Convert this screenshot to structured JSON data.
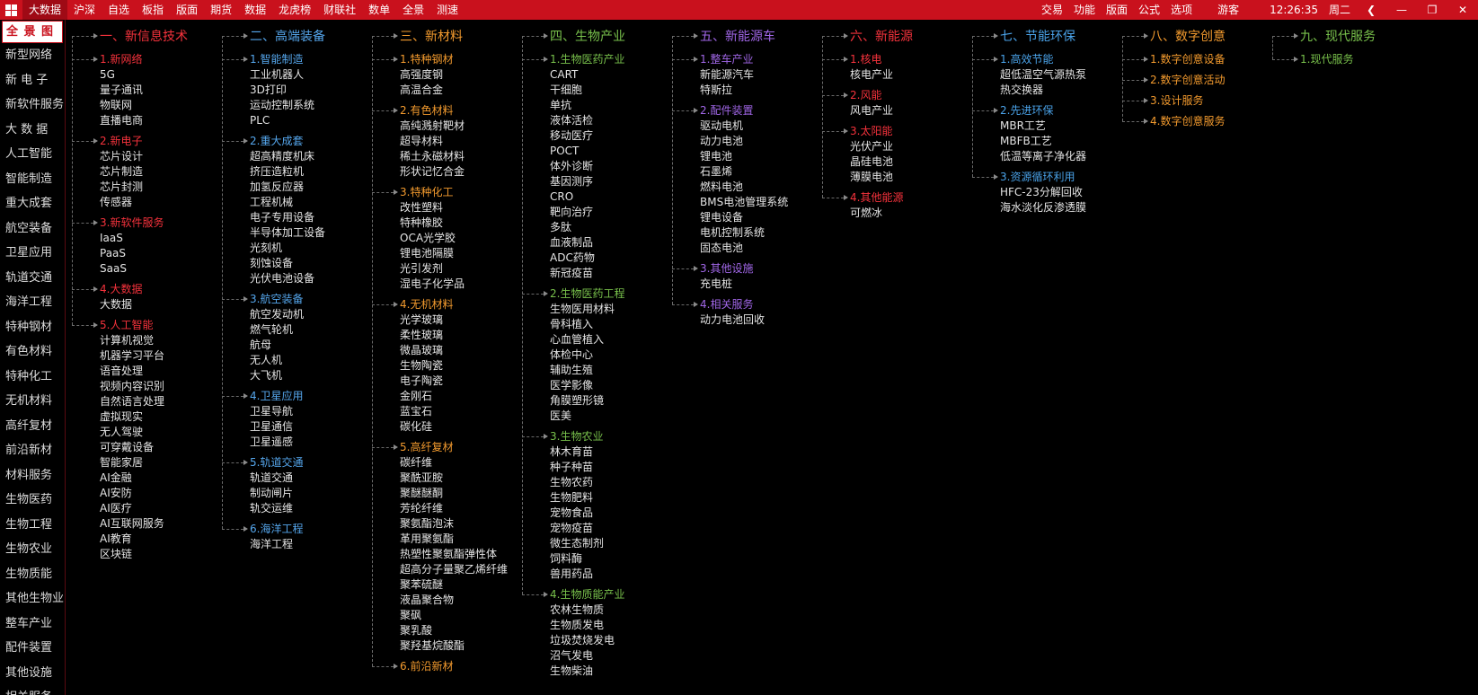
{
  "topbar": {
    "menu": [
      "大数据",
      "沪深",
      "自选",
      "板指",
      "版面",
      "期货",
      "数据",
      "龙虎榜",
      "财联社",
      "数单",
      "全景",
      "测速"
    ],
    "active_index": 0,
    "right": [
      "交易",
      "功能",
      "版面",
      "公式",
      "选项"
    ],
    "user": "游客",
    "time": "12:26:35",
    "weekday": "周二"
  },
  "sidebar": {
    "selected": "全 景 图",
    "items": [
      "新型网络",
      "新 电 子",
      "新软件服务",
      "大 数 据",
      "人工智能",
      "智能制造",
      "重大成套",
      "航空装备",
      "卫星应用",
      "轨道交通",
      "海洋工程",
      "特种钢材",
      "有色材料",
      "特种化工",
      "无机材料",
      "高纤复材",
      "前沿新材",
      "材料服务",
      "生物医药",
      "生物工程",
      "生物农业",
      "生物质能",
      "其他生物业",
      "整车产业",
      "配件装置",
      "其他设施",
      "相关服务"
    ]
  },
  "colors": {
    "red": "#f5323c",
    "blue": "#55a6ec",
    "orange": "#f29a2e",
    "green": "#78c04b",
    "purple": "#a066e6",
    "sky": "#4aa2e8"
  },
  "columns": [
    {
      "title": "一、新信息技术",
      "color": "red",
      "subs": [
        {
          "title": "1.新网络",
          "items": [
            "5G",
            "量子通讯",
            "物联网",
            "直播电商"
          ]
        },
        {
          "title": "2.新电子",
          "items": [
            "芯片设计",
            "芯片制造",
            "芯片封测",
            "传感器"
          ]
        },
        {
          "title": "3.新软件服务",
          "items": [
            "IaaS",
            "PaaS",
            "SaaS"
          ]
        },
        {
          "title": "4.大数据",
          "items": [
            "大数据"
          ]
        },
        {
          "title": "5.人工智能",
          "items": [
            "计算机视觉",
            "机器学习平台",
            "语音处理",
            "视频内容识别",
            "自然语言处理",
            "虚拟现实",
            "无人驾驶",
            "可穿戴设备",
            "智能家居",
            "AI金融",
            "AI安防",
            "AI医疗",
            "AI互联网服务",
            "AI教育",
            "区块链"
          ]
        }
      ]
    },
    {
      "title": "二、高端装备",
      "color": "blue",
      "subs": [
        {
          "title": "1.智能制造",
          "items": [
            "工业机器人",
            "3D打印",
            "运动控制系统",
            "PLC"
          ]
        },
        {
          "title": "2.重大成套",
          "items": [
            "超高精度机床",
            "挤压造粒机",
            "加氢反应器",
            "工程机械",
            "电子专用设备",
            "半导体加工设备",
            "光刻机",
            "刻蚀设备",
            "光伏电池设备"
          ]
        },
        {
          "title": "3.航空装备",
          "items": [
            "航空发动机",
            "燃气轮机",
            "航母",
            "无人机",
            "大飞机"
          ]
        },
        {
          "title": "4.卫星应用",
          "items": [
            "卫星导航",
            "卫星通信",
            "卫星遥感"
          ]
        },
        {
          "title": "5.轨道交通",
          "items": [
            "轨道交通",
            "制动闸片",
            "轨交运维"
          ]
        },
        {
          "title": "6.海洋工程",
          "items": [
            "海洋工程"
          ]
        }
      ]
    },
    {
      "title": "三、新材料",
      "color": "orange",
      "subs": [
        {
          "title": "1.特种钢材",
          "items": [
            "高强度钢",
            "高温合金"
          ]
        },
        {
          "title": "2.有色材料",
          "items": [
            "高纯溅射靶材",
            "超导材料",
            "稀土永磁材料",
            "形状记忆合金"
          ]
        },
        {
          "title": "3.特种化工",
          "items": [
            "改性塑料",
            "特种橡胶",
            "OCA光学胶",
            "锂电池隔膜",
            "光引发剂",
            "湿电子化学品"
          ]
        },
        {
          "title": "4.无机材料",
          "items": [
            "光学玻璃",
            "柔性玻璃",
            "微晶玻璃",
            "生物陶瓷",
            "电子陶瓷",
            "金刚石",
            "蓝宝石",
            "碳化硅"
          ]
        },
        {
          "title": "5.高纤复材",
          "items": [
            "碳纤维",
            "聚酰亚胺",
            "聚醚醚酮",
            "芳纶纤维",
            "聚氨酯泡沫",
            "革用聚氨酯",
            "热塑性聚氨酯弹性体",
            "超高分子量聚乙烯纤维",
            "聚苯硫醚",
            "液晶聚合物",
            "聚砜",
            "聚乳酸",
            "聚羟基烷酸酯"
          ]
        },
        {
          "title": "6.前沿新材",
          "items": []
        }
      ]
    },
    {
      "title": "四、生物产业",
      "color": "green",
      "subs": [
        {
          "title": "1.生物医药产业",
          "items": [
            "CART",
            "干细胞",
            "单抗",
            "液体活检",
            "移动医疗",
            "POCT",
            "体外诊断",
            "基因测序",
            "CRO",
            "靶向治疗",
            "多肽",
            "血液制品",
            "ADC药物",
            "新冠疫苗"
          ]
        },
        {
          "title": "2.生物医药工程",
          "items": [
            "生物医用材料",
            "骨科植入",
            "心血管植入",
            "体检中心",
            "辅助生殖",
            "医学影像",
            "角膜塑形镜",
            "医美"
          ]
        },
        {
          "title": "3.生物农业",
          "items": [
            "林木育苗",
            "种子种苗",
            "生物农药",
            "生物肥料",
            "宠物食品",
            "宠物疫苗",
            "微生态制剂",
            "饲料酶",
            "兽用药品"
          ]
        },
        {
          "title": "4.生物质能产业",
          "items": [
            "农林生物质",
            "生物质发电",
            "垃圾焚烧发电",
            "沼气发电",
            "生物柴油"
          ]
        }
      ]
    },
    {
      "title": "五、新能源车",
      "color": "purple",
      "subs": [
        {
          "title": "1.整车产业",
          "items": [
            "新能源汽车",
            "特斯拉"
          ]
        },
        {
          "title": "2.配件装置",
          "items": [
            "驱动电机",
            "动力电池",
            "锂电池",
            "石墨烯",
            "燃料电池",
            "BMS电池管理系统",
            "锂电设备",
            "电机控制系统",
            "固态电池"
          ]
        },
        {
          "title": "3.其他设施",
          "items": [
            "充电桩"
          ]
        },
        {
          "title": "4.相关服务",
          "items": [
            "动力电池回收"
          ]
        }
      ]
    },
    {
      "title": "六、新能源",
      "color": "red",
      "subs": [
        {
          "title": "1.核电",
          "items": [
            "核电产业"
          ]
        },
        {
          "title": "2.风能",
          "items": [
            "风电产业"
          ]
        },
        {
          "title": "3.太阳能",
          "items": [
            "光伏产业",
            "晶硅电池",
            "薄膜电池"
          ]
        },
        {
          "title": "4.其他能源",
          "items": [
            "可燃冰"
          ]
        }
      ]
    },
    {
      "title": "七、节能环保",
      "color": "sky",
      "subs": [
        {
          "title": "1.高效节能",
          "items": [
            "超低温空气源热泵",
            "热交换器"
          ]
        },
        {
          "title": "2.先进环保",
          "items": [
            "MBR工艺",
            "MBFB工艺",
            "低温等离子净化器"
          ]
        },
        {
          "title": "3.资源循环利用",
          "items": [
            "HFC-23分解回收",
            "海水淡化反渗透膜"
          ]
        }
      ]
    },
    {
      "title": "八、数字创意",
      "color": "orange",
      "subs": [
        {
          "title": "1.数字创意设备",
          "items": []
        },
        {
          "title": "2.数字创意活动",
          "items": []
        },
        {
          "title": "3.设计服务",
          "items": []
        },
        {
          "title": "4.数字创意服务",
          "items": []
        }
      ]
    },
    {
      "title": "九、现代服务",
      "color": "green",
      "subs": [
        {
          "title": "1.现代服务",
          "items": []
        }
      ]
    }
  ]
}
